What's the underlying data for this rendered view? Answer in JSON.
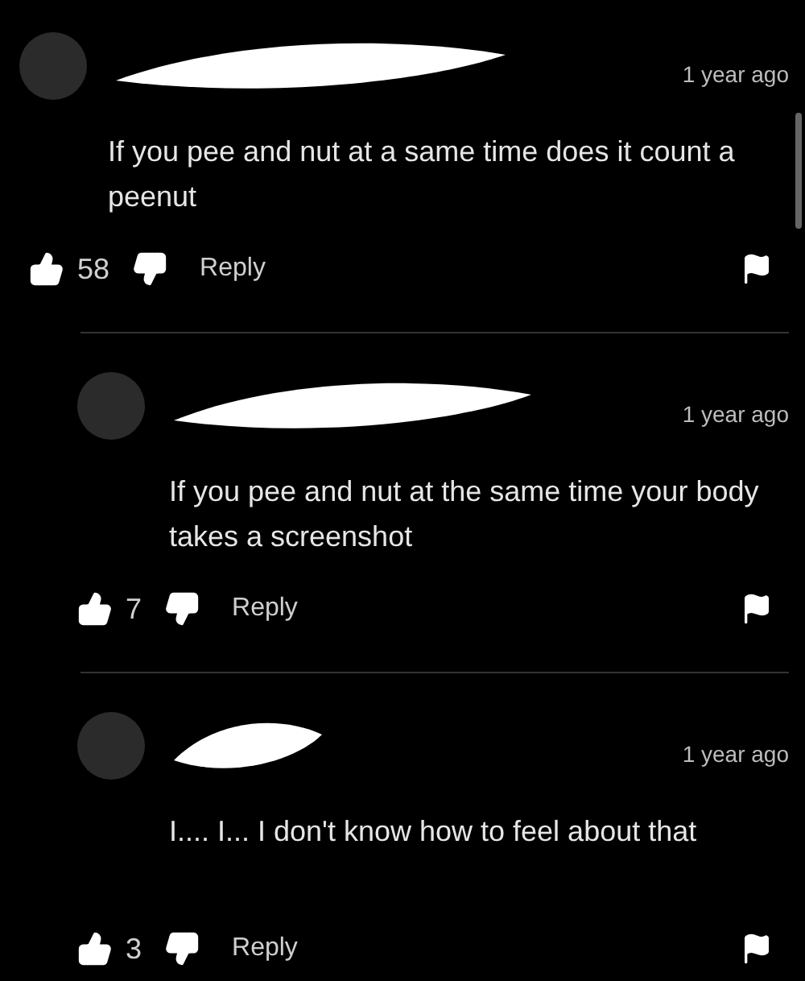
{
  "comments": [
    {
      "time": "1 year ago",
      "text": "If you pee and nut at a same time does it count a peenut",
      "likes": "58",
      "reply_label": "Reply",
      "replies": [
        {
          "time": "1 year ago",
          "text": "If you pee and nut at the same time your body takes a screenshot",
          "likes": "7",
          "reply_label": "Reply"
        },
        {
          "time": "1 year ago",
          "text": "I.... I... I don't know how to feel about that",
          "likes": "3",
          "reply_label": "Reply"
        }
      ]
    }
  ]
}
